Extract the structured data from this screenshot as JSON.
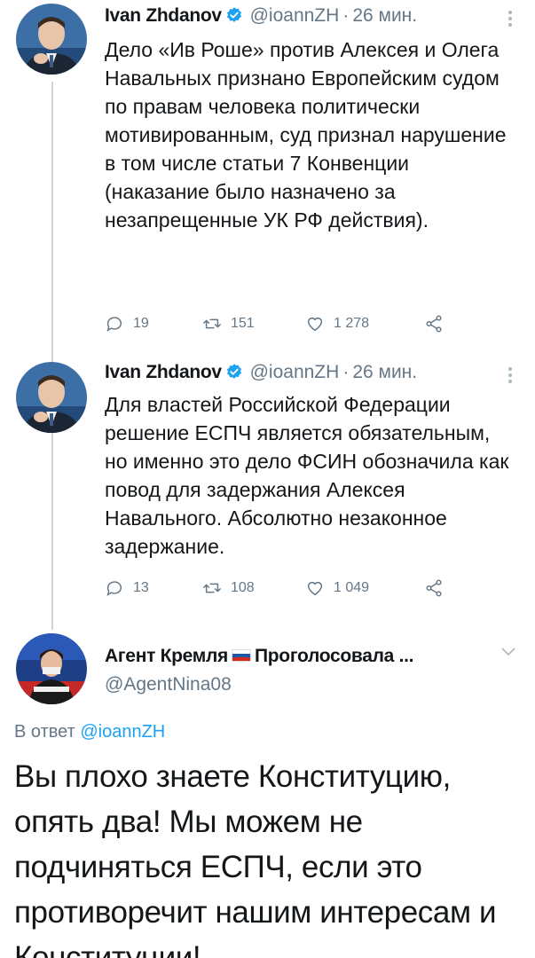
{
  "thread": [
    {
      "author_name": "Ivan Zhdanov",
      "handle": "@ioannZH",
      "separator": "·",
      "time": "26 мин.",
      "text": "Дело «Ив Роше» против Алексея и Олега Навальных признано Европейским судом по правам человека политически мотивированным, суд признал нарушение в том числе статьи 7 Конвенции (наказание было назначено за незапрещенные УК РФ действия).",
      "replies": "19",
      "retweets": "151",
      "likes": "1 278"
    },
    {
      "author_name": "Ivan Zhdanov",
      "handle": "@ioannZH",
      "separator": "·",
      "time": "26 мин.",
      "text": "Для властей Российской Федерации решение ЕСПЧ является обязательным, но именно это дело ФСИН обозначила как повод для задержания Алексея Навального. Абсолютно незаконное задержание.",
      "replies": "13",
      "retweets": "108",
      "likes": "1 049"
    }
  ],
  "reply": {
    "author_name_left": "Агент Кремля",
    "author_name_right": "Проголосовала ...",
    "handle": "@AgentNina08",
    "reply_prefix": "В ответ",
    "reply_to": "@ioannZH",
    "text": "Вы плохо знаете Конституцию, опять два! Мы можем не подчиняться ЕСПЧ, если это противоречит нашим интересам и Конституции!"
  },
  "colors": {
    "accent": "#1da1f2",
    "secondary_text": "#657786",
    "primary_text": "#14171a",
    "thread_line": "#ccd6dd"
  },
  "icons": [
    "verified-badge-icon",
    "more-icon",
    "reply-icon",
    "retweet-icon",
    "like-icon",
    "share-icon",
    "chevron-down-icon",
    "russian-flag-icon"
  ]
}
